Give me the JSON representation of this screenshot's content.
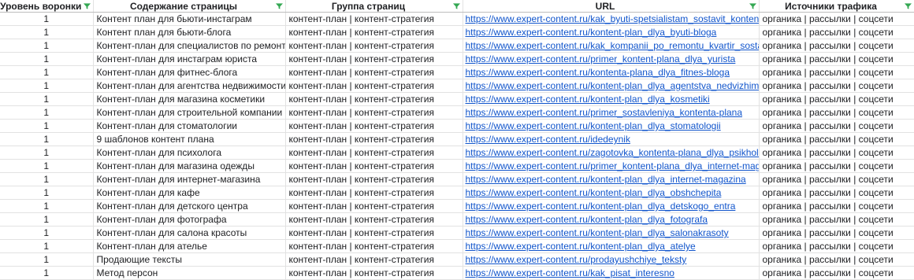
{
  "headers": [
    "Уровень воронки",
    "Содержание страницы",
    "Группа страниц",
    "URL",
    "Источники трафика"
  ],
  "filter_icon": "filter-icon",
  "colors": {
    "link": "#1155cc",
    "filter": "#34a853"
  },
  "rows": [
    [
      "1",
      "Контент план для бьюти-инстаграм",
      "контент-план | контент-стратегия",
      "https://www.expert-content.ru/kak_byuti-spetsialistam_sostavit_kontent-plan",
      "органика | рассылки | соцсети"
    ],
    [
      "1",
      "Контент план для бьюти-блога",
      "контент-план | контент-стратегия",
      "https://www.expert-content.ru/kontent-plan_dlya_byuti-bloga",
      "органика | рассылки | соцсети"
    ],
    [
      "1",
      "Контент-план для специалистов по ремонту",
      "контент-план | контент-стратегия",
      "https://www.expert-content.ru/kak_kompanii_po_remontu_kvartir_sostavit",
      "органика | рассылки | соцсети"
    ],
    [
      "1",
      "Контент-план для инстаграм юриста",
      "контент-план | контент-стратегия",
      "https://www.expert-content.ru/primer_kontent-plana_dlya_yurista",
      "органика | рассылки | соцсети"
    ],
    [
      "1",
      "Контент-план для фитнес-блога",
      "контент-план | контент-стратегия",
      "https://www.expert-content.ru/kontenta-plana_dlya_fitnes-bloga",
      "органика | рассылки | соцсети"
    ],
    [
      "1",
      "Контент-план для агентства недвижимости",
      "контент-план | контент-стратегия",
      "https://www.expert-content.ru/kontent-plan_dlya_agentstva_nedvizhimosti",
      "органика | рассылки | соцсети"
    ],
    [
      "1",
      "Контент-план для магазина косметики",
      "контент-план | контент-стратегия",
      "https://www.expert-content.ru/kontent-plan_dlya_kosmetiki",
      "органика | рассылки | соцсети"
    ],
    [
      "1",
      "Контент-план для строительной компании",
      "контент-план | контент-стратегия",
      "https://www.expert-content.ru/primer_sostavleniya_kontenta-plana",
      "органика | рассылки | соцсети"
    ],
    [
      "1",
      "Контент-план для стоматологии",
      "контент-план | контент-стратегия",
      "https://www.expert-content.ru/kontent-plan_dlya_stomatologii",
      "органика | рассылки | соцсети"
    ],
    [
      "1",
      "9 шаблонов контент плана",
      "контент-план | контент-стратегия",
      "https://www.expert-content.ru/idedeynik",
      "органика | рассылки | соцсети"
    ],
    [
      "1",
      "Контент-план для психолога",
      "контент-план | контент-стратегия",
      "https://www.expert-content.ru/zagotovka_kontenta-plana_dlya_psikhologa",
      "органика | рассылки | соцсети"
    ],
    [
      "1",
      "Контент-план для магазина одежды",
      "контент-план | контент-стратегия",
      "https://www.expert-content.ru/primer_kontent-plana_dlya_internet-magazina",
      "органика | рассылки | соцсети"
    ],
    [
      "1",
      "Контент-план для интернет-магазина",
      "контент-план | контент-стратегия",
      "https://www.expert-content.ru/kontent-plan_dlya_internet-magazina",
      "органика | рассылки | соцсети"
    ],
    [
      "1",
      "Контент-план для кафе",
      "контент-план | контент-стратегия",
      "https://www.expert-content.ru/kontent-plan_dlya_obshchepita",
      "органика | рассылки | соцсети"
    ],
    [
      "1",
      "Контент-план для детского центра",
      "контент-план | контент-стратегия",
      "https://www.expert-content.ru/kontent-plan_dlya_detskogo_entra",
      "органика | рассылки | соцсети"
    ],
    [
      "1",
      "Контент-план для фотографа",
      "контент-план | контент-стратегия",
      "https://www.expert-content.ru/kontent-plan_dlya_fotografa",
      "органика | рассылки | соцсети"
    ],
    [
      "1",
      "Контент-план для салона красоты",
      "контент-план | контент-стратегия",
      "https://www.expert-content.ru/kontent-plan_dlya_salonakrasoty",
      "органика | рассылки | соцсети"
    ],
    [
      "1",
      "Контент-план для ателье",
      "контент-план | контент-стратегия",
      "https://www.expert-content.ru/kontent-plan_dlya_atelye",
      "органика | рассылки | соцсети"
    ],
    [
      "1",
      "Продающие тексты",
      "контент-план | контент-стратегия",
      "https://www.expert-content.ru/prodayushchiye_teksty",
      "органика | рассылки | соцсети"
    ],
    [
      "1",
      "Метод персон",
      "контент-план | контент-стратегия",
      "https://www.expert-content.ru/kak_pisat_interesno",
      "органика | рассылки | соцсети"
    ]
  ]
}
